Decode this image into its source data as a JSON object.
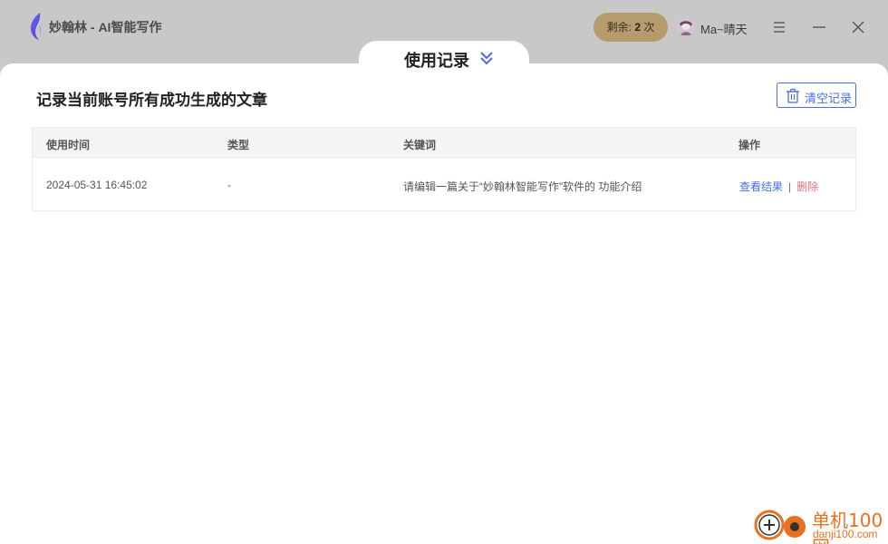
{
  "app": {
    "title": "妙翰林 - AI智能写作",
    "remaining_prefix": "剩余:",
    "remaining_count": "2",
    "remaining_suffix": "次",
    "username": "Ma~晴天"
  },
  "tab": {
    "title": "使用记录"
  },
  "section": {
    "title": "记录当前账号所有成功生成的文章",
    "clear_label": "清空记录"
  },
  "table": {
    "headers": [
      "使用时间",
      "类型",
      "关键词",
      "操作"
    ],
    "rows": [
      {
        "time": "2024-05-31 16:45:02",
        "type": "-",
        "keyword": "请编辑一篇关于“妙翰林智能写作”软件的 功能介绍",
        "view_label": "查看结果",
        "separator": "|",
        "delete_label": "删除"
      }
    ]
  },
  "watermark": {
    "line1": "单机100网",
    "line2": "danji100.com"
  },
  "colors": {
    "accent": "#4a6ee0",
    "danger": "#e0707a",
    "badge": "#b69b6d",
    "watermark": "#e8711e"
  },
  "icons": [
    "app-logo-icon",
    "avatar-icon",
    "menu-icon",
    "minimize-icon",
    "close-icon",
    "chevron-double-down-icon",
    "trash-icon"
  ]
}
